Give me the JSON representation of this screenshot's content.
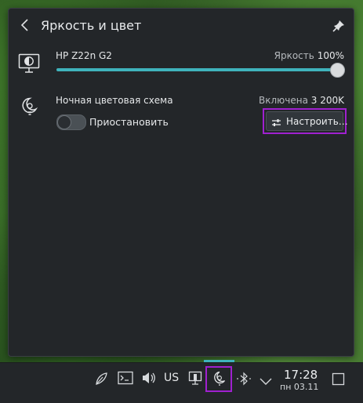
{
  "popup": {
    "title": "Яркость и цвет",
    "back_icon": "chevron-left-icon",
    "pin_icon": "pin-icon"
  },
  "monitor": {
    "name": "HP Z22n G2",
    "brightness_label": "Яркость",
    "brightness_value": "100%",
    "brightness_level": 1.0,
    "icon": "monitor-brightness-icon"
  },
  "night": {
    "label": "Ночная цветовая схема",
    "status_label": "Включена",
    "temperature": "3 200K",
    "toggle_label": "Приостановить",
    "toggle_on": false,
    "configure_label": "Настроить…",
    "icon": "night-light-icon",
    "configure_icon": "sliders-icon"
  },
  "colors": {
    "accent": "#3fb3bc",
    "highlight": "#a020d0",
    "popup_bg": "#232629"
  },
  "taskbar": {
    "keyboard_layout": "US",
    "time": "17:28",
    "date": "пн 03.11",
    "icons": [
      "leaf-icon",
      "terminal-icon",
      "volume-icon",
      "keyboard-layout",
      "network-icon",
      "night-light-icon",
      "bluetooth-icon",
      "chevron-down-icon",
      "show-desktop-icon"
    ]
  }
}
